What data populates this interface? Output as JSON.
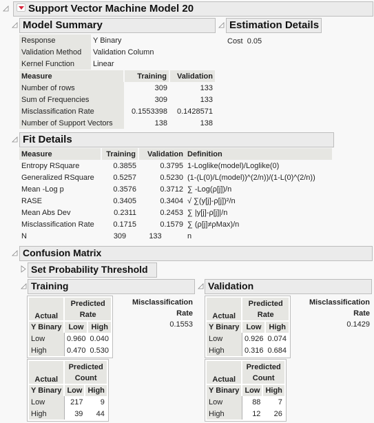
{
  "report": {
    "title": "Support Vector Machine Model 20"
  },
  "model_summary": {
    "title": "Model Summary",
    "info": [
      {
        "label": "Response",
        "value": "Y Binary"
      },
      {
        "label": "Validation Method",
        "value": "Validation Column"
      },
      {
        "label": "Kernel Function",
        "value": "Linear"
      }
    ],
    "columns": [
      "Measure",
      "Training",
      "Validation"
    ],
    "rows": [
      {
        "measure": "Number of rows",
        "training": "309",
        "validation": "133"
      },
      {
        "measure": "Sum of Frequencies",
        "training": "309",
        "validation": "133"
      },
      {
        "measure": "Misclassification Rate",
        "training": "0.1553398",
        "validation": "0.1428571"
      },
      {
        "measure": "Number of Support Vectors",
        "training": "138",
        "validation": "138"
      }
    ]
  },
  "estimation_details": {
    "title": "Estimation Details",
    "cost_label": "Cost",
    "cost_value": "0.05"
  },
  "fit_details": {
    "title": "Fit Details",
    "columns": [
      "Measure",
      "Training",
      "Validation",
      "Definition"
    ],
    "rows": [
      {
        "measure": "Entropy RSquare",
        "training": "0.3855",
        "validation": "0.3795",
        "definition": "1-Loglike(model)/Loglike(0)"
      },
      {
        "measure": "Generalized RSquare",
        "training": "0.5257",
        "validation": "0.5230",
        "definition": "(1-(L(0)/L(model))^(2/n))/(1-L(0)^(2/n))"
      },
      {
        "measure": "Mean -Log p",
        "training": "0.3576",
        "validation": "0.3712",
        "definition": "∑ -Log(ρ[j])/n"
      },
      {
        "measure": "RASE",
        "training": "0.3405",
        "validation": "0.3404",
        "definition": "√ ∑(y[j]-ρ[j])²/n"
      },
      {
        "measure": "Mean Abs Dev",
        "training": "0.2311",
        "validation": "0.2453",
        "definition": "∑ |y[j]-ρ[j]|/n"
      },
      {
        "measure": "Misclassification Rate",
        "training": "0.1715",
        "validation": "0.1579",
        "definition": "∑ (ρ[j]≠ρMax)/n"
      },
      {
        "measure": "N",
        "training": "309",
        "validation": "133",
        "definition": "n"
      }
    ]
  },
  "confusion_matrix": {
    "title": "Confusion Matrix",
    "threshold_title": "Set Probability Threshold",
    "actual_label": "Actual",
    "response_label": "Y Binary",
    "predicted_label": "Predicted",
    "rate_label": "Rate",
    "count_label": "Count",
    "levels": [
      "Low",
      "High"
    ],
    "misclass_label_1": "Misclassification",
    "misclass_label_2": "Rate",
    "training": {
      "title": "Training",
      "rate": [
        [
          "0.960",
          "0.040"
        ],
        [
          "0.470",
          "0.530"
        ]
      ],
      "count": [
        [
          "217",
          "9"
        ],
        [
          "39",
          "44"
        ]
      ],
      "misclassification_rate": "0.1553"
    },
    "validation": {
      "title": "Validation",
      "rate": [
        [
          "0.926",
          "0.074"
        ],
        [
          "0.316",
          "0.684"
        ]
      ],
      "count": [
        [
          "88",
          "7"
        ],
        [
          "12",
          "26"
        ]
      ],
      "misclassification_rate": "0.1429"
    }
  }
}
